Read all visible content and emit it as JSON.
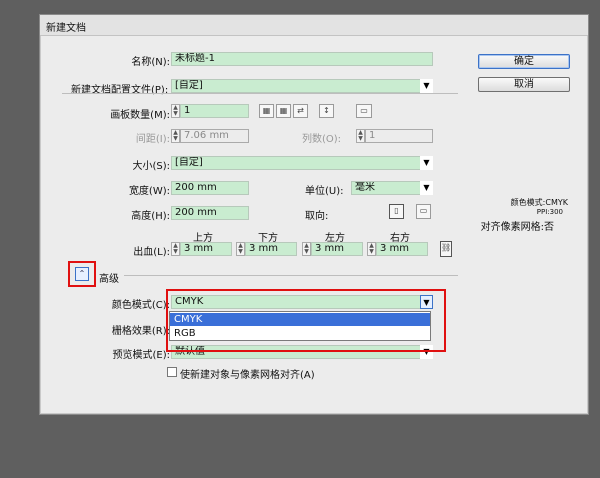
{
  "dialog": {
    "title": "新建文档"
  },
  "buttons": {
    "ok": "确定",
    "cancel": "取消"
  },
  "form": {
    "name_label": "名称(N):",
    "name_value": "未标题-1",
    "profile_label": "新建文档配置文件(P):",
    "profile_value": "[自定]",
    "artboards_label": "画板数量(M):",
    "artboards_value": "1",
    "spacing_label": "间距(I):",
    "spacing_value": "7.06 mm",
    "columns_label": "列数(O):",
    "columns_value": "1",
    "size_label": "大小(S):",
    "size_value": "[自定]",
    "width_label": "宽度(W):",
    "width_value": "200 mm",
    "units_label": "单位(U):",
    "units_value": "毫米",
    "height_label": "高度(H):",
    "height_value": "200 mm",
    "orientation_label": "取向:",
    "bleed_label": "出血(L):",
    "bleed_headers": [
      "上方",
      "下方",
      "左方",
      "右方"
    ],
    "bleed_values": [
      "3 mm",
      "3 mm",
      "3 mm",
      "3 mm"
    ]
  },
  "advanced": {
    "label": "高级",
    "color_mode_label": "颜色模式(C):",
    "color_mode_value": "CMYK",
    "color_mode_options": [
      "CMYK",
      "RGB"
    ],
    "raster_label": "栅格效果(R):",
    "preview_label": "预览模式(E):",
    "preview_value": "默认值",
    "align_pixel_label": "使新建对象与像素网格对齐(A)"
  },
  "summary": {
    "color_mode": "颜色模式:CMYK",
    "ppi": "PPI:300",
    "align": "对齐像素网格:否"
  },
  "colors": {
    "field_bg": "#c9ecd0",
    "highlight": "#3a6fd8",
    "callout_red": "#e01010"
  }
}
